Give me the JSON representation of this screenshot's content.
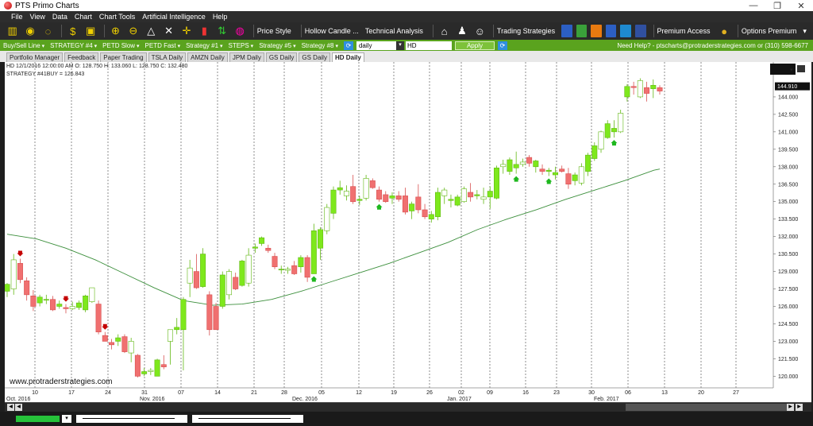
{
  "window": {
    "title": "PTS Primo Charts",
    "buttons": [
      "—",
      "❐",
      "✕"
    ]
  },
  "menu": [
    "File",
    "View",
    "Data",
    "Chart",
    "Chart Tools",
    "Artificial Intelligence",
    "Help"
  ],
  "toolbar": {
    "price_style_label": "Price Style",
    "candle_type_label": "Hollow Candle ...",
    "technical_analysis_label": "Technical Analysis",
    "trading_strategies_label": "Trading Strategies",
    "premium_access_label": "Premium Access",
    "options_premium_label": "Options Premium"
  },
  "strategy_bar": {
    "items": [
      "Buy/Sell Line",
      "STRATEGY #4",
      "PETD Slow",
      "PETD Fast",
      "Strategy #1",
      "STEPS",
      "Strategy #5",
      "Strategy #8"
    ],
    "period_value": "daily",
    "symbol_value": "HD",
    "apply_label": "Apply",
    "help_text": "Need Help? - ptscharts@protraderstrategies.com or (310) 598-6677"
  },
  "tabs": [
    {
      "label": "Portfolio Manager",
      "active": false
    },
    {
      "label": "Feedback",
      "active": false
    },
    {
      "label": "Paper Trading",
      "active": false
    },
    {
      "label": "TSLA Daily",
      "active": false
    },
    {
      "label": "AMZN Daily",
      "active": false
    },
    {
      "label": "JPM Daily",
      "active": false
    },
    {
      "label": "GS Daily",
      "active": false
    },
    {
      "label": "GS Daily",
      "active": false
    },
    {
      "label": "HD Daily",
      "active": true
    }
  ],
  "chart_info": {
    "line1": "HD 12/1/2016 12:00:00 AM O: 128.750 H: 133.060 L: 128.750 C: 132.480",
    "line2": "STRATEGY #41BUY = 126.843",
    "watermark": "www.protraderstrategies.com",
    "last_price": "144.910"
  },
  "chart_data": {
    "type": "candlestick",
    "ylim": [
      119.0,
      147.0
    ],
    "y_ticks": [
      "120.000",
      "121.500",
      "123.000",
      "124.500",
      "126.000",
      "127.500",
      "129.000",
      "130.500",
      "132.000",
      "133.500",
      "135.000",
      "136.500",
      "138.000",
      "139.500",
      "141.000",
      "142.500",
      "144.000"
    ],
    "x_ticks": [
      "10",
      "17",
      "24",
      "31",
      "07",
      "14",
      "21",
      "28",
      "05",
      "12",
      "19",
      "26",
      "02",
      "09",
      "16",
      "23",
      "30",
      "06",
      "13",
      "20",
      "27"
    ],
    "month_labels": [
      "Oct. 2016",
      "Nov. 2016",
      "Dec. 2016",
      "Jan. 2017",
      "Feb. 2017"
    ],
    "candles": [
      {
        "o": 127.3,
        "h": 128.0,
        "l": 126.8,
        "c": 127.9
      },
      {
        "o": 127.5,
        "h": 130.5,
        "l": 127.0,
        "c": 130.0
      },
      {
        "o": 129.7,
        "h": 130.1,
        "l": 128.0,
        "c": 128.3
      },
      {
        "o": 128.2,
        "h": 128.5,
        "l": 126.5,
        "c": 127.0
      },
      {
        "o": 126.9,
        "h": 127.4,
        "l": 125.6,
        "c": 126.0
      },
      {
        "o": 126.3,
        "h": 127.0,
        "l": 126.0,
        "c": 126.8
      },
      {
        "o": 126.6,
        "h": 127.0,
        "l": 126.2,
        "c": 126.6
      },
      {
        "o": 126.6,
        "h": 126.9,
        "l": 125.6,
        "c": 125.7
      },
      {
        "o": 126.0,
        "h": 126.5,
        "l": 125.8,
        "c": 126.2
      },
      {
        "o": 125.9,
        "h": 126.2,
        "l": 125.4,
        "c": 125.8
      },
      {
        "o": 125.8,
        "h": 126.4,
        "l": 125.7,
        "c": 126.0
      },
      {
        "o": 125.9,
        "h": 126.5,
        "l": 125.7,
        "c": 126.3
      },
      {
        "o": 125.7,
        "h": 127.0,
        "l": 125.5,
        "c": 126.9
      },
      {
        "o": 126.4,
        "h": 127.6,
        "l": 126.3,
        "c": 127.6
      },
      {
        "o": 126.2,
        "h": 126.5,
        "l": 123.6,
        "c": 123.8
      },
      {
        "o": 123.5,
        "h": 123.8,
        "l": 123.0,
        "c": 123.0
      },
      {
        "o": 122.9,
        "h": 123.2,
        "l": 122.3,
        "c": 122.7
      },
      {
        "o": 123.0,
        "h": 123.6,
        "l": 122.6,
        "c": 123.3
      },
      {
        "o": 123.4,
        "h": 123.6,
        "l": 122.0,
        "c": 122.1
      },
      {
        "o": 122.0,
        "h": 123.3,
        "l": 121.2,
        "c": 123.0
      },
      {
        "o": 121.8,
        "h": 121.9,
        "l": 119.9,
        "c": 120.0
      },
      {
        "o": 120.2,
        "h": 120.7,
        "l": 120.0,
        "c": 120.4
      },
      {
        "o": 120.4,
        "h": 120.7,
        "l": 120.1,
        "c": 120.5
      },
      {
        "o": 120.0,
        "h": 121.5,
        "l": 120.0,
        "c": 121.4
      },
      {
        "o": 121.0,
        "h": 121.8,
        "l": 120.6,
        "c": 120.8
      },
      {
        "o": 123.0,
        "h": 124.0,
        "l": 121.0,
        "c": 124.0
      },
      {
        "o": 124.0,
        "h": 125.0,
        "l": 123.6,
        "c": 124.2
      },
      {
        "o": 124.0,
        "h": 126.8,
        "l": 120.5,
        "c": 126.6
      },
      {
        "o": 128.0,
        "h": 130.0,
        "l": 126.8,
        "c": 129.3
      },
      {
        "o": 129.0,
        "h": 130.5,
        "l": 127.5,
        "c": 127.6
      },
      {
        "o": 127.7,
        "h": 131.0,
        "l": 127.6,
        "c": 130.5
      },
      {
        "o": 127.0,
        "h": 127.3,
        "l": 123.5,
        "c": 124.0
      },
      {
        "o": 126.0,
        "h": 126.3,
        "l": 124.0,
        "c": 124.0
      },
      {
        "o": 126.0,
        "h": 129.0,
        "l": 125.8,
        "c": 128.7
      },
      {
        "o": 127.0,
        "h": 129.2,
        "l": 126.6,
        "c": 129.0
      },
      {
        "o": 128.5,
        "h": 128.9,
        "l": 127.4,
        "c": 127.5
      },
      {
        "o": 127.8,
        "h": 130.0,
        "l": 127.7,
        "c": 129.9
      },
      {
        "o": 128.0,
        "h": 131.0,
        "l": 127.7,
        "c": 130.4
      },
      {
        "o": 131.0,
        "h": 131.4,
        "l": 130.6,
        "c": 131.1
      },
      {
        "o": 131.4,
        "h": 132.0,
        "l": 131.2,
        "c": 131.9
      },
      {
        "o": 131.0,
        "h": 131.3,
        "l": 130.6,
        "c": 130.8
      },
      {
        "o": 130.3,
        "h": 130.6,
        "l": 129.2,
        "c": 129.4
      },
      {
        "o": 129.2,
        "h": 129.5,
        "l": 128.8,
        "c": 129.2
      },
      {
        "o": 129.1,
        "h": 129.4,
        "l": 128.8,
        "c": 129.2
      },
      {
        "o": 129.5,
        "h": 129.9,
        "l": 128.7,
        "c": 128.8
      },
      {
        "o": 129.4,
        "h": 130.4,
        "l": 128.9,
        "c": 130.2
      },
      {
        "o": 130.2,
        "h": 130.4,
        "l": 128.1,
        "c": 128.5
      },
      {
        "o": 128.8,
        "h": 133.1,
        "l": 128.8,
        "c": 132.5
      },
      {
        "o": 131.0,
        "h": 132.8,
        "l": 130.0,
        "c": 132.6
      },
      {
        "o": 132.5,
        "h": 134.8,
        "l": 132.2,
        "c": 134.5
      },
      {
        "o": 134.0,
        "h": 136.3,
        "l": 133.5,
        "c": 136.0
      },
      {
        "o": 136.0,
        "h": 136.8,
        "l": 135.6,
        "c": 136.2
      },
      {
        "o": 135.5,
        "h": 136.4,
        "l": 135.1,
        "c": 135.9
      },
      {
        "o": 136.3,
        "h": 137.3,
        "l": 134.8,
        "c": 135.0
      },
      {
        "o": 135.1,
        "h": 135.5,
        "l": 134.7,
        "c": 135.2
      },
      {
        "o": 135.3,
        "h": 137.3,
        "l": 135.1,
        "c": 137.0
      },
      {
        "o": 136.8,
        "h": 137.0,
        "l": 136.1,
        "c": 136.2
      },
      {
        "o": 136.0,
        "h": 136.3,
        "l": 135.0,
        "c": 135.2
      },
      {
        "o": 135.6,
        "h": 135.9,
        "l": 134.9,
        "c": 135.0
      },
      {
        "o": 135.3,
        "h": 135.8,
        "l": 134.8,
        "c": 135.5
      },
      {
        "o": 135.5,
        "h": 135.9,
        "l": 135.0,
        "c": 135.2
      },
      {
        "o": 135.5,
        "h": 136.2,
        "l": 133.9,
        "c": 134.1
      },
      {
        "o": 134.2,
        "h": 135.0,
        "l": 133.5,
        "c": 134.8
      },
      {
        "o": 135.4,
        "h": 136.5,
        "l": 134.0,
        "c": 134.3
      },
      {
        "o": 134.3,
        "h": 134.8,
        "l": 133.5,
        "c": 133.7
      },
      {
        "o": 133.5,
        "h": 134.2,
        "l": 133.2,
        "c": 133.9
      },
      {
        "o": 133.7,
        "h": 136.2,
        "l": 133.4,
        "c": 135.8
      },
      {
        "o": 135.5,
        "h": 136.2,
        "l": 134.8,
        "c": 136.0
      },
      {
        "o": 135.1,
        "h": 135.6,
        "l": 134.5,
        "c": 135.2
      },
      {
        "o": 134.7,
        "h": 135.6,
        "l": 134.6,
        "c": 135.4
      },
      {
        "o": 135.0,
        "h": 136.3,
        "l": 134.9,
        "c": 136.1
      },
      {
        "o": 135.8,
        "h": 136.6,
        "l": 135.0,
        "c": 135.4
      },
      {
        "o": 135.5,
        "h": 136.0,
        "l": 135.2,
        "c": 135.6
      },
      {
        "o": 135.2,
        "h": 136.2,
        "l": 134.8,
        "c": 135.4
      },
      {
        "o": 135.4,
        "h": 136.3,
        "l": 134.4,
        "c": 135.9
      },
      {
        "o": 135.3,
        "h": 138.1,
        "l": 135.2,
        "c": 137.9
      },
      {
        "o": 138.0,
        "h": 138.6,
        "l": 137.4,
        "c": 138.2
      },
      {
        "o": 137.6,
        "h": 138.8,
        "l": 137.3,
        "c": 138.6
      },
      {
        "o": 137.9,
        "h": 139.3,
        "l": 137.4,
        "c": 138.2
      },
      {
        "o": 138.2,
        "h": 138.7,
        "l": 138.0,
        "c": 138.4
      },
      {
        "o": 138.8,
        "h": 139.0,
        "l": 138.0,
        "c": 138.3
      },
      {
        "o": 138.0,
        "h": 138.6,
        "l": 137.5,
        "c": 138.5
      },
      {
        "o": 137.8,
        "h": 138.2,
        "l": 137.3,
        "c": 137.6
      },
      {
        "o": 137.6,
        "h": 137.9,
        "l": 137.2,
        "c": 137.7
      },
      {
        "o": 137.3,
        "h": 138.0,
        "l": 136.9,
        "c": 137.5
      },
      {
        "o": 137.8,
        "h": 138.1,
        "l": 137.5,
        "c": 137.6
      },
      {
        "o": 137.4,
        "h": 137.9,
        "l": 136.1,
        "c": 136.5
      },
      {
        "o": 136.8,
        "h": 137.5,
        "l": 136.4,
        "c": 137.3
      },
      {
        "o": 136.6,
        "h": 138.3,
        "l": 136.4,
        "c": 138.0
      },
      {
        "o": 137.6,
        "h": 139.2,
        "l": 137.2,
        "c": 139.0
      },
      {
        "o": 138.7,
        "h": 140.1,
        "l": 138.5,
        "c": 139.8
      },
      {
        "o": 139.5,
        "h": 141.1,
        "l": 139.2,
        "c": 141.0
      },
      {
        "o": 140.5,
        "h": 142.0,
        "l": 140.4,
        "c": 141.7
      },
      {
        "o": 141.0,
        "h": 142.0,
        "l": 140.5,
        "c": 141.3
      },
      {
        "o": 141.0,
        "h": 142.9,
        "l": 140.9,
        "c": 142.6
      },
      {
        "o": 144.0,
        "h": 145.1,
        "l": 143.6,
        "c": 144.9
      },
      {
        "o": 144.9,
        "h": 145.3,
        "l": 144.2,
        "c": 144.8
      },
      {
        "o": 144.0,
        "h": 145.6,
        "l": 143.9,
        "c": 145.4
      },
      {
        "o": 144.8,
        "h": 145.3,
        "l": 143.6,
        "c": 144.3
      },
      {
        "o": 144.7,
        "h": 145.5,
        "l": 143.9,
        "c": 145.0
      },
      {
        "o": 144.8,
        "h": 145.0,
        "l": 144.2,
        "c": 144.5
      }
    ],
    "moving_average": [
      [
        0,
        132.2
      ],
      [
        5,
        131.8
      ],
      [
        10,
        131.0
      ],
      [
        15,
        130.0
      ],
      [
        20,
        128.8
      ],
      [
        25,
        127.6
      ],
      [
        30,
        126.5
      ],
      [
        35,
        126.1
      ],
      [
        40,
        126.2
      ],
      [
        45,
        126.6
      ],
      [
        50,
        127.3
      ],
      [
        55,
        128.1
      ],
      [
        60,
        128.9
      ],
      [
        65,
        129.7
      ],
      [
        70,
        130.6
      ],
      [
        75,
        131.5
      ],
      [
        80,
        132.6
      ],
      [
        85,
        133.5
      ],
      [
        90,
        134.3
      ],
      [
        95,
        135.2
      ],
      [
        100,
        136.0
      ],
      [
        105,
        136.8
      ],
      [
        110,
        137.7
      ],
      [
        111,
        137.8
      ]
    ],
    "sell_arrows": [
      2,
      9,
      15
    ],
    "buy_arrows": [
      47,
      57,
      78,
      83,
      93
    ]
  }
}
